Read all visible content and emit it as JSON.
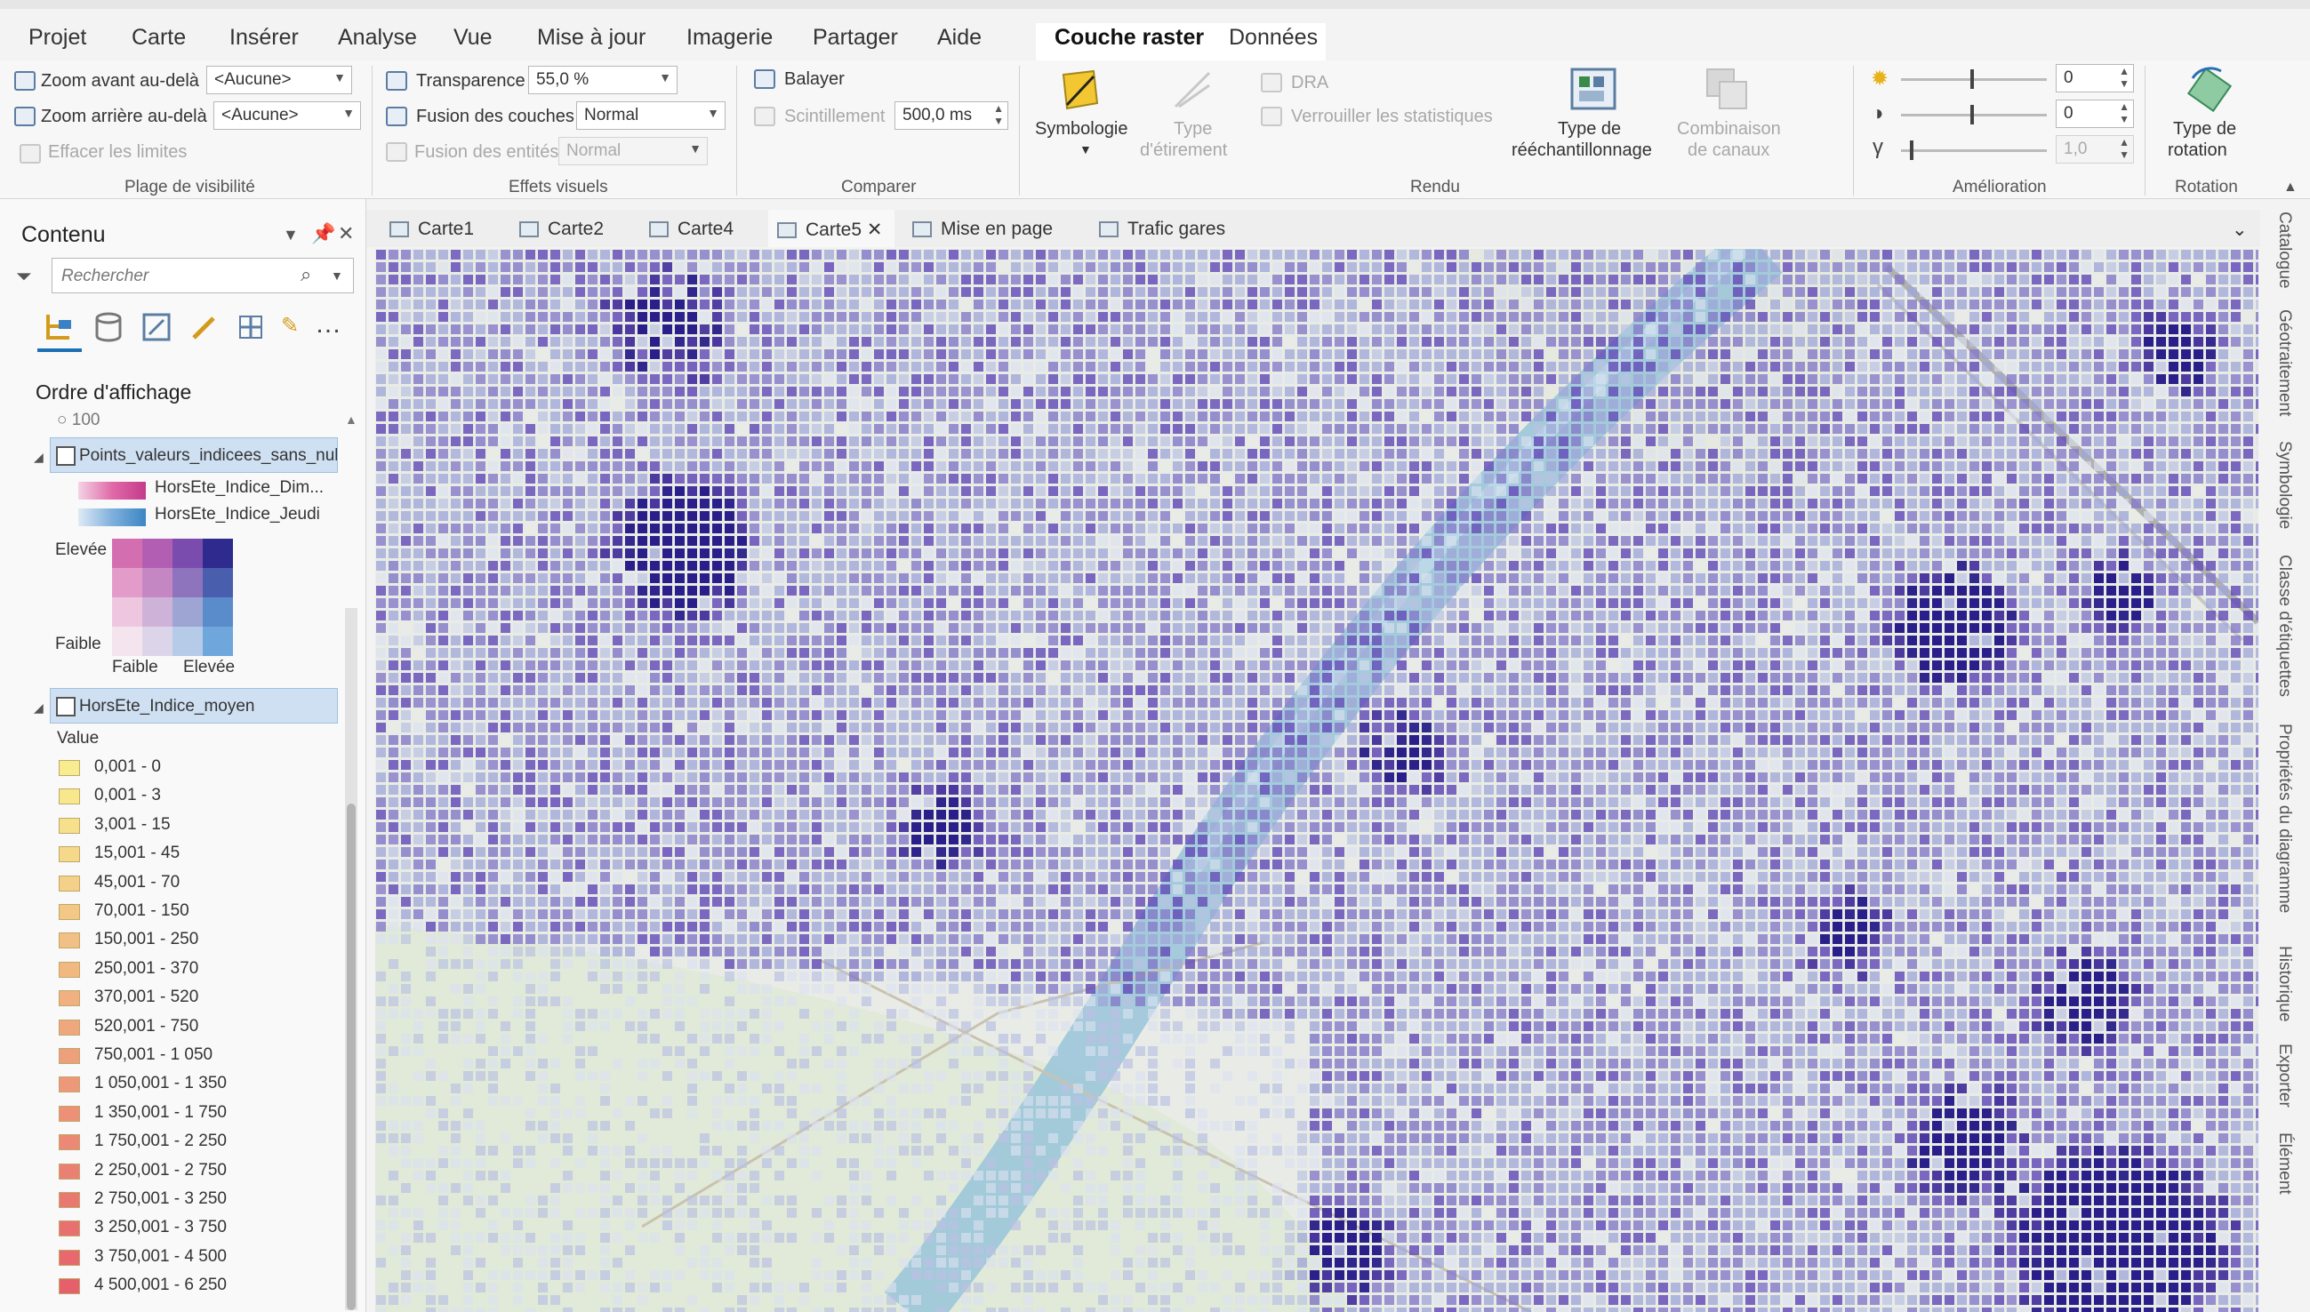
{
  "menu": {
    "items": [
      "Projet",
      "Carte",
      "Insérer",
      "Analyse",
      "Vue",
      "Mise à jour",
      "Imagerie",
      "Partager",
      "Aide"
    ],
    "context_tabs": [
      "Couche raster",
      "Données"
    ]
  },
  "ribbon": {
    "visibility": {
      "zoom_in_label": "Zoom avant au-delà",
      "zoom_in_value": "<Aucune>",
      "zoom_out_label": "Zoom arrière au-delà",
      "zoom_out_value": "<Aucune>",
      "clear_label": "Effacer les limites",
      "group_label": "Plage de visibilité"
    },
    "effects": {
      "transparency_label": "Transparence",
      "transparency_value": "55,0 %",
      "layer_blend_label": "Fusion des couches",
      "layer_blend_value": "Normal",
      "feature_blend_label": "Fusion des entités",
      "feature_blend_value": "Normal",
      "group_label": "Effets visuels"
    },
    "compare": {
      "swipe_label": "Balayer",
      "flicker_label": "Scintillement",
      "flicker_value": "500,0",
      "flicker_unit": "ms",
      "group_label": "Comparer"
    },
    "rendering": {
      "symbology_label": "Symbologie",
      "stretch_label_1": "Type",
      "stretch_label_2": "d'étirement",
      "dra_label": "DRA",
      "lock_stats_label": "Verrouiller les statistiques",
      "resample_label_1": "Type de",
      "resample_label_2": "rééchantillonnage",
      "band_combo_label_1": "Combinaison",
      "band_combo_label_2": "de canaux",
      "group_label": "Rendu"
    },
    "enhancement": {
      "brightness_value": "0",
      "contrast_value": "0",
      "gamma_value": "1,0",
      "group_label": "Amélioration"
    },
    "rotation": {
      "label_1": "Type de",
      "label_2": "rotation",
      "group_label": "Rotation"
    }
  },
  "contents": {
    "title": "Contenu",
    "search_placeholder": "Rechercher",
    "draw_order_label": "Ordre d'affichage",
    "partial_value": "100",
    "layer1": {
      "name": "Points_valeurs_indicees_sans_nul",
      "sub1": "HorsEte_Indice_Dim...",
      "sub2": "HorsEte_Indice_Jeudi",
      "high": "Elevée",
      "low": "Faible",
      "x_low": "Faible",
      "x_high": "Elevée"
    },
    "layer2": {
      "name": "HorsEte_Indice_moyen",
      "field": "Value",
      "classes": [
        {
          "label": "0,001 - 0",
          "color": "#f7ec8f"
        },
        {
          "label": "0,001 - 3",
          "color": "#f7e88e"
        },
        {
          "label": "3,001 - 15",
          "color": "#f6e08c"
        },
        {
          "label": "15,001 - 45",
          "color": "#f5d88a"
        },
        {
          "label": "45,001 - 70",
          "color": "#f4d088"
        },
        {
          "label": "70,001 - 150",
          "color": "#f3c886"
        },
        {
          "label": "150,001 - 250",
          "color": "#f2c084"
        },
        {
          "label": "250,001 - 370",
          "color": "#f1b882"
        },
        {
          "label": "370,001 - 520",
          "color": "#f0b080"
        },
        {
          "label": "520,001 - 750",
          "color": "#efa87e"
        },
        {
          "label": "750,001 - 1 050",
          "color": "#eea07c"
        },
        {
          "label": "1 050,001 - 1 350",
          "color": "#ed987a"
        },
        {
          "label": "1 350,001 - 1 750",
          "color": "#ec9078"
        },
        {
          "label": "1 750,001 - 2 250",
          "color": "#eb8876"
        },
        {
          "label": "2 250,001 - 2 750",
          "color": "#ea8074"
        },
        {
          "label": "2 750,001 - 3 250",
          "color": "#e97872"
        },
        {
          "label": "3 250,001 - 3 750",
          "color": "#e87070"
        },
        {
          "label": "3 750,001 - 4 500",
          "color": "#e7686e"
        },
        {
          "label": "4 500,001 - 6 250",
          "color": "#e6606c"
        }
      ]
    }
  },
  "map_tabs": [
    {
      "label": "Carte1",
      "active": false
    },
    {
      "label": "Carte2",
      "active": false
    },
    {
      "label": "Carte4",
      "active": false
    },
    {
      "label": "Carte5",
      "active": true
    },
    {
      "label": "Mise en page",
      "active": false
    },
    {
      "label": "Trafic gares",
      "active": false
    }
  ],
  "side_tabs": [
    "Catalogue",
    "Géotraitement",
    "Symbologie",
    "Classe d'étiquettes",
    "Propriétés du diagramme",
    "Historique",
    "Exporter",
    "Élément"
  ],
  "colors": {
    "accent": "#1a6fb6",
    "selection": "#cfe0f2",
    "map_purple_dark": "#2a1f8a",
    "map_purple_mid": "#6a5cc0",
    "map_blue_light": "#a9b9de",
    "river": "#9cc6d9"
  }
}
